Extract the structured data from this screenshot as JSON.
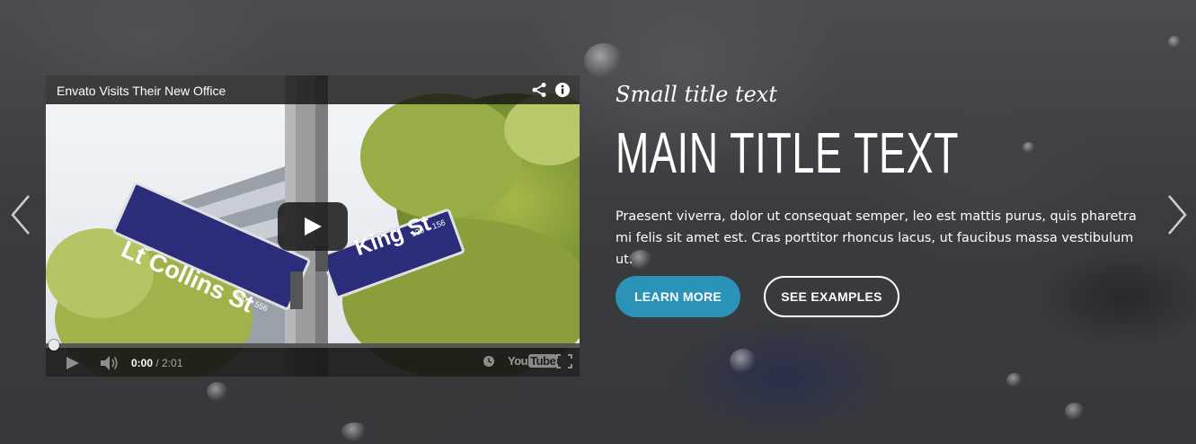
{
  "slide": {
    "small_title": "Small title text",
    "main_title": "MAIN TITLE TEXT",
    "description": "Praesent viverra, dolor ut consequat semper, leo est mattis purus, quis pharetra mi felis sit amet est. Cras porttitor rhoncus lacus, ut faucibus massa vestibulum ut.",
    "buttons": {
      "primary_label": "LEARN MORE",
      "secondary_label": "SEE EXAMPLES"
    }
  },
  "video": {
    "title": "Envato Visits Their New Office",
    "current_time": "0:00",
    "duration": "/ 2:01",
    "progress": 0,
    "logo_text": "You",
    "logo_tube": "Tube",
    "signs": {
      "left": "Lt Collins St",
      "left_number": "490 – 556",
      "right": "King St",
      "right_number": "120 – 156"
    }
  },
  "navigation": {
    "prev_icon": "chevron-left-icon",
    "next_icon": "chevron-right-icon"
  },
  "colors": {
    "accent": "#2b93b8",
    "text": "#ffffff"
  }
}
